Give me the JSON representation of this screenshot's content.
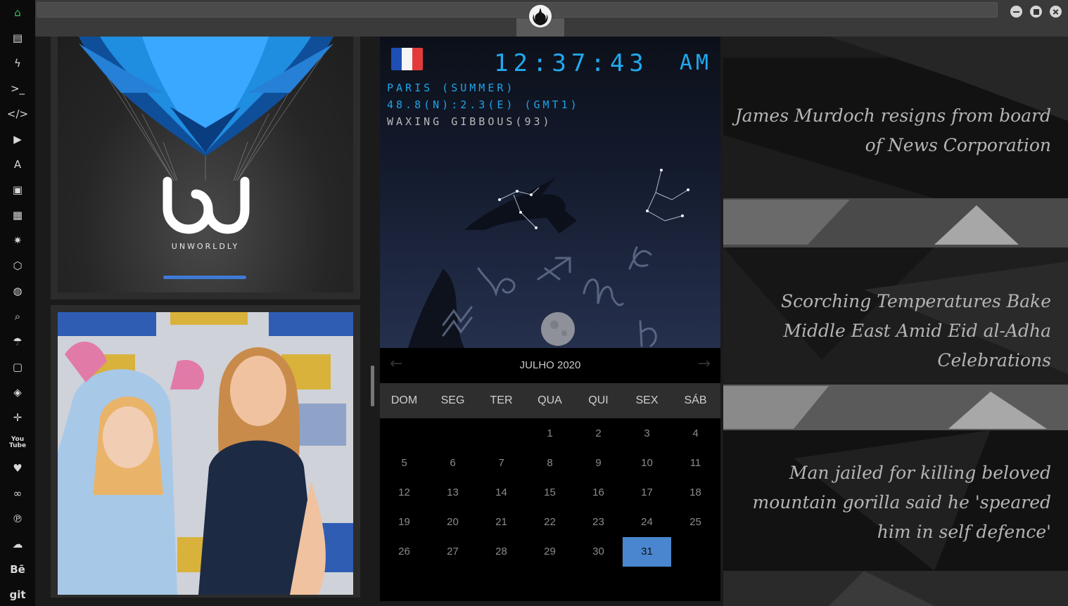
{
  "sidebar": {
    "items": [
      {
        "name": "home-icon",
        "glyph": "⌂",
        "active": true
      },
      {
        "name": "document-icon",
        "glyph": "▤"
      },
      {
        "name": "lightning-icon",
        "glyph": "ϟ"
      },
      {
        "name": "terminal-icon",
        "glyph": ">_"
      },
      {
        "name": "code-icon",
        "glyph": "</>"
      },
      {
        "name": "play-icon",
        "glyph": "▶"
      },
      {
        "name": "translate-icon",
        "glyph": "A"
      },
      {
        "name": "image-icon",
        "glyph": "▣"
      },
      {
        "name": "newspaper-icon",
        "glyph": "▦"
      },
      {
        "name": "rebel-alliance-icon",
        "glyph": "✷"
      },
      {
        "name": "cube-icon",
        "glyph": "⬡"
      },
      {
        "name": "globe-icon",
        "glyph": "◍"
      },
      {
        "name": "search-icon",
        "glyph": "⌕"
      },
      {
        "name": "umbrella-icon",
        "glyph": "☂"
      },
      {
        "name": "contact-card-icon",
        "glyph": "▢"
      },
      {
        "name": "code-fork-icon",
        "glyph": "◈"
      },
      {
        "name": "expand-icon",
        "glyph": "✛"
      },
      {
        "name": "youtube-icon",
        "glyph": "You Tube"
      },
      {
        "name": "heart-icon",
        "glyph": "♥"
      },
      {
        "name": "infinity-icon",
        "glyph": "∞"
      },
      {
        "name": "pinterest-icon",
        "glyph": "℗"
      },
      {
        "name": "cloud-icon",
        "glyph": "☁"
      },
      {
        "name": "behance-icon",
        "glyph": "Bē"
      },
      {
        "name": "git-icon",
        "glyph": "git"
      }
    ]
  },
  "titlebar": {
    "logo_icon": "rebel-alliance-icon",
    "buttons": [
      "minimize-icon",
      "maximize-icon",
      "close-icon"
    ]
  },
  "unworldly": {
    "wordmark": "UNWORLDLY",
    "accent": "#3f7ad8"
  },
  "clock": {
    "time": "12:37:43",
    "ampm": "AM",
    "city": "PARIS (SUMMER)",
    "coords": "48.8(N):2.3(E) (GMT1)",
    "moon_phase": "WAXING GIBBOUS(93)",
    "flag": [
      "#1f4fb5",
      "#f5f5f5",
      "#e33b3b"
    ],
    "accent": "#22a9ee"
  },
  "calendar": {
    "month": "JULHO 2020",
    "prev_icon": "chevron-left-icon",
    "next_icon": "chevron-right-icon",
    "weekdays": [
      "DOM",
      "SEG",
      "TER",
      "QUA",
      "QUI",
      "SEX",
      "SÁB"
    ],
    "weeks": [
      [
        "",
        "",
        "",
        "1",
        "2",
        "3",
        "4"
      ],
      [
        "5",
        "6",
        "7",
        "8",
        "9",
        "10",
        "11"
      ],
      [
        "12",
        "13",
        "14",
        "15",
        "16",
        "17",
        "18"
      ],
      [
        "19",
        "20",
        "21",
        "22",
        "23",
        "24",
        "25"
      ],
      [
        "26",
        "27",
        "28",
        "29",
        "30",
        "31",
        ""
      ]
    ],
    "today": "31",
    "highlight": "#4a86d0"
  },
  "news": [
    {
      "headline": "James Murdoch resigns from board of News Corporation"
    },
    {
      "headline": "Scorching Temperatures Bake Middle East Amid Eid al-Adha Celebrations"
    },
    {
      "headline": "Man jailed for killing beloved mountain gorilla said he 'speared him in self defence'"
    }
  ]
}
